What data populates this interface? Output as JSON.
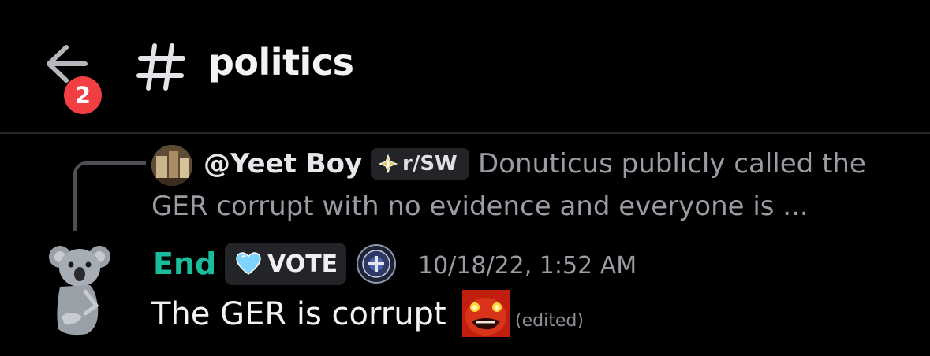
{
  "header": {
    "channel_name": "politics",
    "notification_count": "2"
  },
  "reply": {
    "author": "@Yeet Boy",
    "tag": "r/SW",
    "preview_line1": "Donuticus publicly called the",
    "preview_line2": "GER corrupt with no evidence and everyone is ..."
  },
  "message": {
    "author": "End",
    "badge": "VOTE",
    "timestamp": "10/18/22, 1:52 AM",
    "text": "The GER is corrupt",
    "edited": "(edited)"
  },
  "colors": {
    "background": "#000000",
    "author_color": "#1abc9c",
    "badge_red": "#f23f43",
    "muted_text": "#9b9ca3"
  },
  "icons": {
    "back": "arrow-left-icon",
    "channel": "hash-icon",
    "tag": "sparkle-icon",
    "badge": "heart-icon",
    "seal": "server-seal-icon",
    "emoji": "angry-face-emoji"
  }
}
